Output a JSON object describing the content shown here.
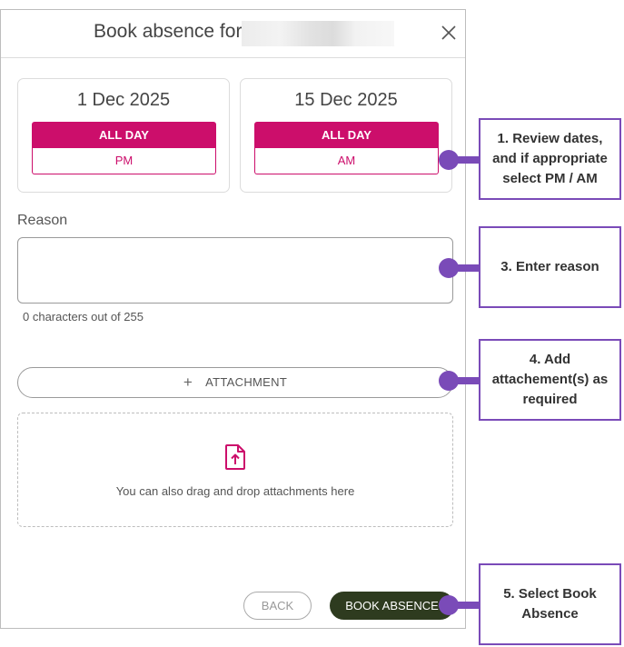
{
  "dialog": {
    "title": "Book absence for",
    "start": {
      "date": "1 Dec 2025",
      "primary": "ALL DAY",
      "secondary": "PM"
    },
    "end": {
      "date": "15 Dec 2025",
      "primary": "ALL DAY",
      "secondary": "AM"
    },
    "reason": {
      "label": "Reason",
      "value": "",
      "counter": "0 characters out of 255"
    },
    "attachment": {
      "button_label": "ATTACHMENT",
      "drop_hint": "You can also drag and drop attachments here"
    },
    "buttons": {
      "back": "BACK",
      "book": "BOOK ABSENCE"
    }
  },
  "callouts": [
    {
      "text": "1. Review dates, and if appropriate select PM / AM"
    },
    {
      "text": "3. Enter reason"
    },
    {
      "text": "4. Add attachement(s) as required"
    },
    {
      "text": "5. Select Book Absence"
    }
  ],
  "colors": {
    "accent": "#cc0e6b",
    "primary_button": "#2e3b1f",
    "callout": "#7a4bb8"
  },
  "icons": [
    "close-icon",
    "plus-icon",
    "file-upload-icon"
  ]
}
